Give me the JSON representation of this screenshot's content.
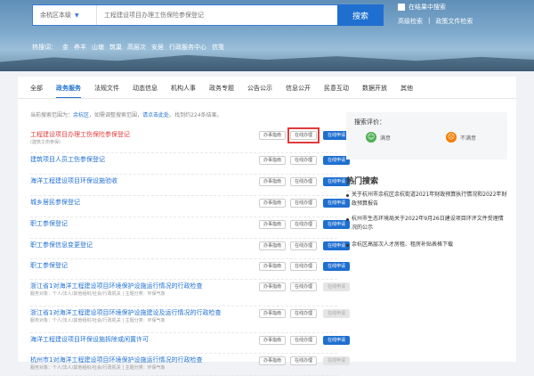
{
  "search": {
    "region": "余杭区本级",
    "placeholder": "工程建设项目办理工伤保险参保登记",
    "button": "搜索",
    "in_results": "在结果中搜索",
    "advanced": "高级检索",
    "policy": "政策文件检索"
  },
  "hot_words": {
    "label": "热搜词：",
    "items": [
      "金",
      "养羊",
      "山塘",
      "筑巢",
      "高层次",
      "安居",
      "行政服务中心",
      "信笺"
    ]
  },
  "tabs": [
    "全部",
    "政务服务",
    "法规文件",
    "动态信息",
    "机构人事",
    "政务专题",
    "公告公示",
    "信息公开",
    "民意互动",
    "数据开放",
    "其他"
  ],
  "active_tab": "政务服务",
  "status": {
    "prefix": "当前搜索范围为：",
    "scope": "余杭区",
    "mid": "，如需调整搜索范围，",
    "link": "请点击此处",
    "suffix": "。找到约224条结果。"
  },
  "buttons": {
    "guide": "办事指南",
    "online": "在线办理",
    "apply": "在线申请"
  },
  "results": [
    {
      "title": "工程建设项目办理工伤保险参保登记",
      "sub": "(建筑工伤参保)",
      "red": true,
      "highlight": true,
      "disabled": false
    },
    {
      "title": "建筑项目人员工伤参保登记",
      "sub": "",
      "red": false,
      "highlight": false,
      "disabled": false
    },
    {
      "title": "海洋工程建设项目环保设施验收",
      "sub": "",
      "red": false,
      "highlight": false,
      "disabled": false
    },
    {
      "title": "城乡居民参保登记",
      "sub": "",
      "red": false,
      "highlight": false,
      "disabled": false
    },
    {
      "title": "职工参保登记",
      "sub": "",
      "red": false,
      "highlight": false,
      "disabled": false
    },
    {
      "title": "职工参保信息变更登记",
      "sub": "",
      "red": false,
      "highlight": false,
      "disabled": false
    },
    {
      "title": "职工参保登记",
      "sub": "",
      "red": false,
      "highlight": false,
      "disabled": false
    },
    {
      "title": "浙江省1对海洋工程建设项目环境保护设施运行情况的行政检查",
      "sub": "服务对象：个人/法人/其他组织/社会/行政机关 | 主题分类：环保气象",
      "red": false,
      "highlight": false,
      "disabled": true
    },
    {
      "title": "浙江省1对海洋工程建设项目环境保护设施建设及运行情况的行政检查",
      "sub": "服务对象：个人/法人/其他组织/社会/行政机关 | 主题分类：环保气象",
      "red": false,
      "highlight": false,
      "disabled": true
    },
    {
      "title": "海洋工程建设项目环保设施拆除或闲置许可",
      "sub": "",
      "red": false,
      "highlight": false,
      "disabled": false
    },
    {
      "title": "杭州市1对海洋工程建设项目环境保护设施运行情况的行政检查",
      "sub": "服务对象：个人/法人/其他组织/社会/行政机关 | 主题分类：环保气象",
      "red": false,
      "highlight": false,
      "disabled": true
    }
  ],
  "rating": {
    "label": "搜索评价：",
    "good": "满意",
    "bad": "不满意"
  },
  "hot_search": {
    "title": "热门搜索",
    "items": [
      "关于杭州市余杭区余杭街道2021年财政预算执行情况和2022年财政预算报告",
      "杭州市生态环境局关于2022年9月26日建设项目环评文件受理情况的公示",
      "余杭区高层次人才房租、租房补贴表格下载"
    ]
  },
  "colors": {
    "accent": "#1f6fd0",
    "highlight": "#e03b3b"
  }
}
